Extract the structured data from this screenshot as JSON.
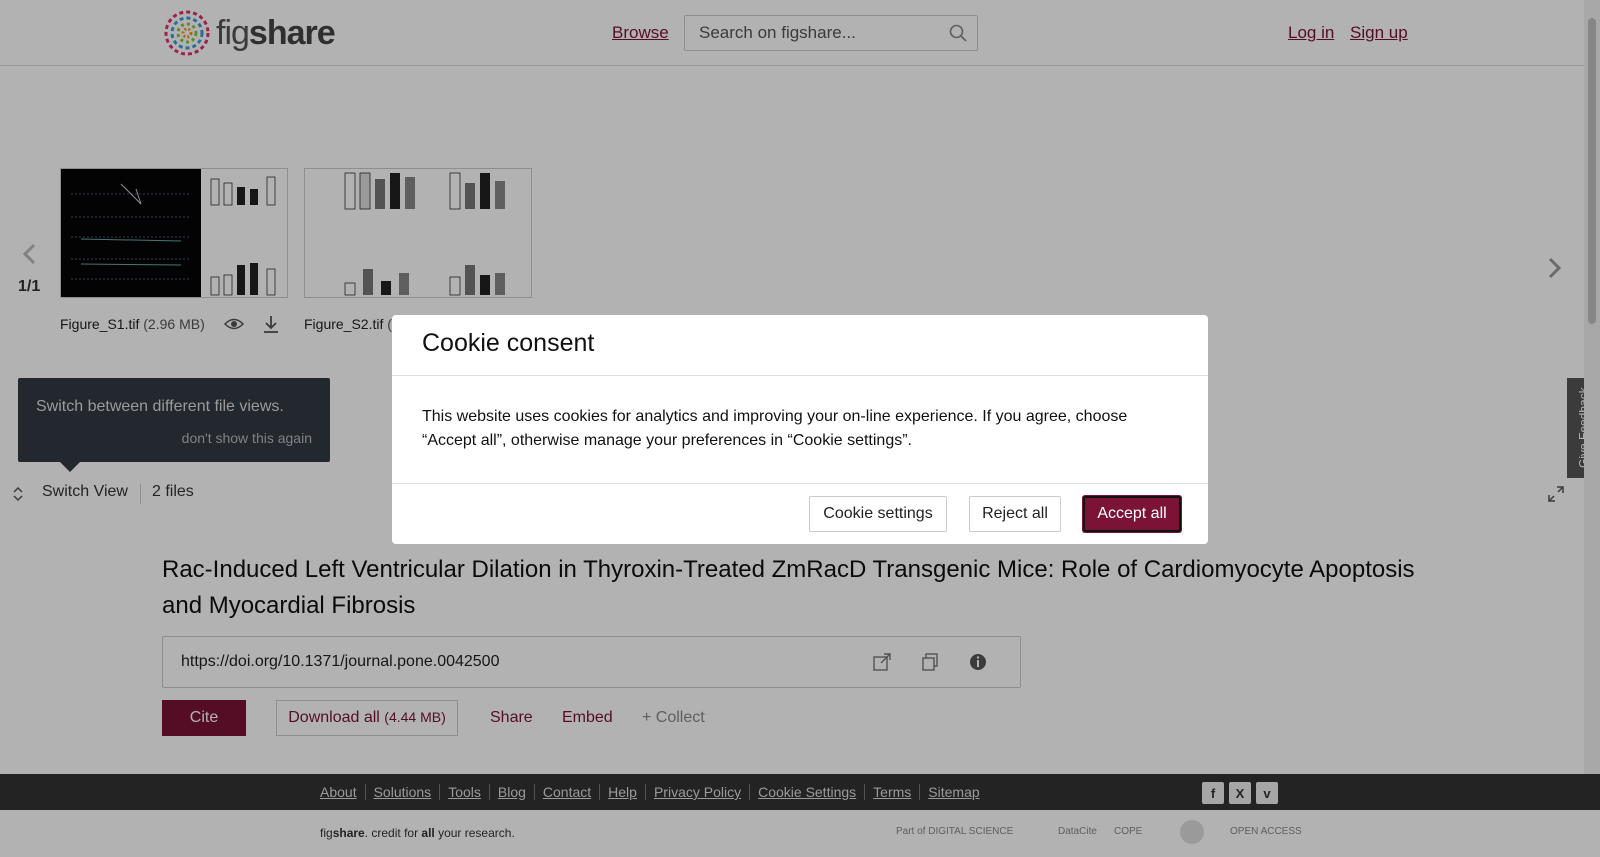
{
  "header": {
    "logo_fig": "fig",
    "logo_share": "share",
    "browse": "Browse",
    "search_placeholder": "Search on figshare...",
    "login": "Log in",
    "signup": "Sign up"
  },
  "viewer": {
    "pager": "1/1",
    "files": [
      {
        "name": "Figure_S1.tif",
        "size": "(2.96 MB)"
      },
      {
        "name": "Figure_S2.tif",
        "size": "("
      }
    ],
    "tooltip_text": "Switch between different file views.",
    "tooltip_dismiss": "don't show this again",
    "switch_view": "Switch View",
    "files_count": "2 files",
    "feedback": "Give Feedback"
  },
  "article": {
    "title": "Rac-Induced Left Ventricular Dilation in Thyroxin-Treated ZmRacD Transgenic Mice: Role of Cardiomyocyte Apoptosis and Myocardial Fibrosis",
    "doi": "https://doi.org/10.1371/journal.pone.0042500",
    "cite": "Cite",
    "download_all": "Download all",
    "download_size": "(4.44 MB)",
    "share": "Share",
    "embed": "Embed",
    "collect": "+ Collect"
  },
  "footer": {
    "links": [
      "About",
      "Solutions",
      "Tools",
      "Blog",
      "Contact",
      "Help",
      "Privacy Policy",
      "Cookie Settings",
      "Terms",
      "Sitemap"
    ],
    "tagline_fig": "fig",
    "tagline_share": "share",
    "tagline_mid": ". credit for ",
    "tagline_all": "all",
    "tagline_end": " your research.",
    "partners": [
      "Part of DIGITAL SCIENCE",
      "DataCite",
      "COPE",
      "OPEN ACCESS"
    ],
    "social_icons": [
      "facebook-icon",
      "x-icon",
      "vimeo-icon"
    ]
  },
  "cookie_modal": {
    "title": "Cookie consent",
    "body": "This website uses cookies for analytics and improving your on-line experience. If you agree, choose “Accept all”, otherwise manage your preferences in “Cookie settings”.",
    "settings": "Cookie settings",
    "reject": "Reject all",
    "accept": "Accept all"
  },
  "colors": {
    "brand": "#7a1336",
    "footer_bg": "#333333"
  }
}
